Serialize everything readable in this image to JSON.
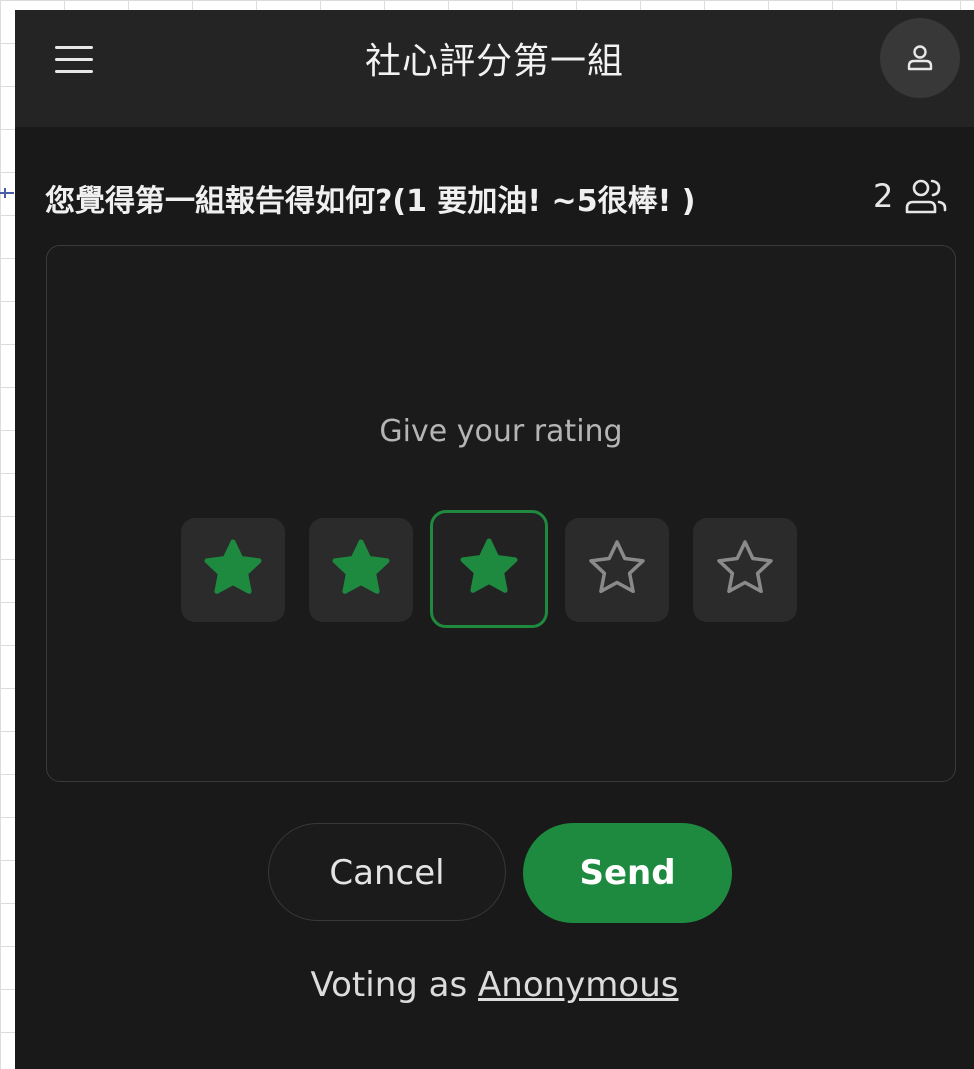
{
  "header": {
    "title": "社心評分第一組",
    "menu_icon": "hamburger-menu-icon",
    "profile_icon": "user-icon"
  },
  "question": {
    "text": "您覺得第一組報告得如何?(1 要加油! ~5很棒! )",
    "voter_count": "2",
    "voter_icon": "users-icon"
  },
  "rating": {
    "prompt": "Give your rating",
    "max": 5,
    "value": 3
  },
  "actions": {
    "cancel_label": "Cancel",
    "send_label": "Send"
  },
  "footer": {
    "prefix": "Voting as",
    "identity": "Anonymous"
  },
  "colors": {
    "background": "#191919",
    "topbar": "#242424",
    "accent": "#1e8a3f",
    "star_empty": "#8a8a8a"
  }
}
